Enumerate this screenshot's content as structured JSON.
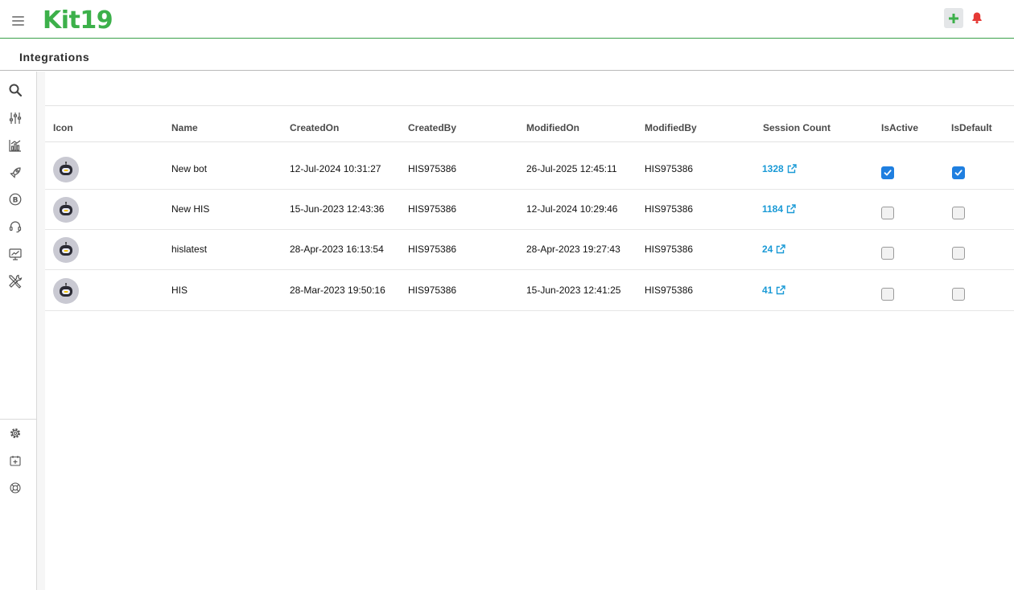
{
  "app": {
    "logo": "Kit19"
  },
  "header": {
    "title": "Integrations"
  },
  "table": {
    "columns": [
      "Icon",
      "Name",
      "CreatedOn",
      "CreatedBy",
      "ModifiedOn",
      "ModifiedBy",
      "Session Count",
      "IsActive",
      "IsDefault"
    ],
    "rows": [
      {
        "name": "New bot",
        "created_on": "12-Jul-2024 10:31:27",
        "created_by": "HIS975386",
        "modified_on": "26-Jul-2025 12:45:11",
        "modified_by": "HIS975386",
        "session_count": "1328",
        "is_active": true,
        "is_default": true
      },
      {
        "name": "New HIS",
        "created_on": "15-Jun-2023 12:43:36",
        "created_by": "HIS975386",
        "modified_on": "12-Jul-2024 10:29:46",
        "modified_by": "HIS975386",
        "session_count": "1184",
        "is_active": false,
        "is_default": false
      },
      {
        "name": "hislatest",
        "created_on": "28-Apr-2023 16:13:54",
        "created_by": "HIS975386",
        "modified_on": "28-Apr-2023 19:27:43",
        "modified_by": "HIS975386",
        "session_count": "24",
        "is_active": false,
        "is_default": false
      },
      {
        "name": "HIS",
        "created_on": "28-Mar-2023 19:50:16",
        "created_by": "HIS975386",
        "modified_on": "15-Jun-2023 12:41:25",
        "modified_by": "HIS975386",
        "session_count": "41",
        "is_active": false,
        "is_default": false
      }
    ]
  },
  "sidebar": {
    "top_icons": [
      "search-icon",
      "sliders-icon",
      "analytics-icon",
      "rocket-icon",
      "billing-icon",
      "headset-icon",
      "monitor-chart-icon",
      "tools-icon"
    ],
    "bottom_icons": [
      "gear-icon",
      "add-calendar-icon",
      "help-icon"
    ]
  },
  "colors": {
    "brand": "#3cb04a",
    "link": "#1a9ad6",
    "checkbox_on": "#1f7fe0",
    "bell": "#e53935"
  }
}
